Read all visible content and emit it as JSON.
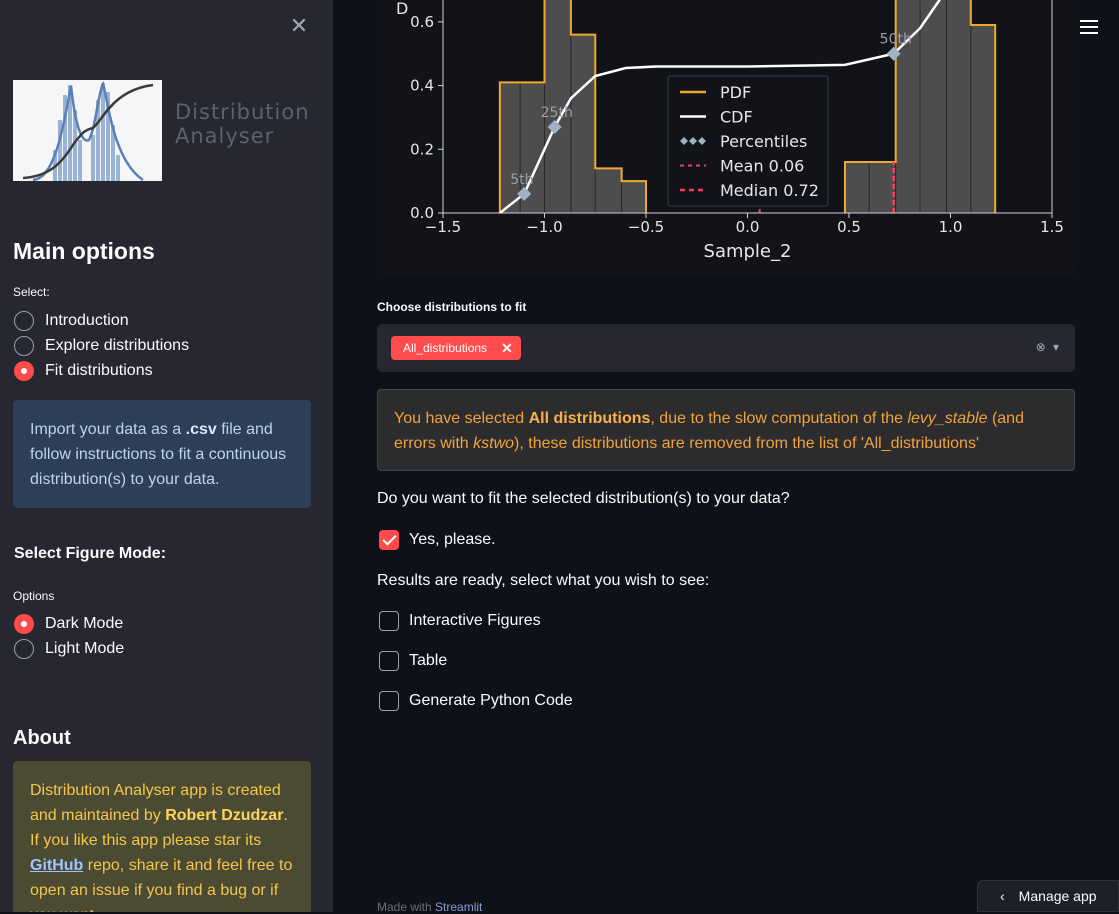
{
  "sidebar": {
    "close_icon": "close-icon",
    "logo_text_line1": "Distribution",
    "logo_text_line2": "Analyser",
    "main_options_heading": "Main options",
    "select_label": "Select:",
    "nav_options": [
      {
        "label": "Introduction",
        "selected": false
      },
      {
        "label": "Explore distributions",
        "selected": false
      },
      {
        "label": "Fit distributions",
        "selected": true
      }
    ],
    "info_text_1": "Import your data as a ",
    "info_text_bold": ".csv",
    "info_text_2": " file and follow instructions to fit a continuous distribution(s) to your data.",
    "figure_mode_heading": "Select Figure Mode:",
    "options_label": "Options",
    "mode_options": [
      {
        "label": "Dark Mode",
        "selected": true
      },
      {
        "label": "Light Mode",
        "selected": false
      }
    ],
    "about_heading": "About",
    "about_text_1": "Distribution Analyser app is created and maintained by ",
    "about_author": "Robert Dzudzar",
    "about_text_2": ". If you like this app please star its ",
    "about_link": "GitHub",
    "about_text_3": " repo, share it and feel free to open an issue if you find a bug or if you want"
  },
  "chart_data": {
    "type": "histogram",
    "xlabel": "Sample_2",
    "ylabel": "D",
    "xlim": [
      -1.5,
      1.5
    ],
    "ylim": [
      0.0,
      0.7
    ],
    "xticks": [
      "−1.5",
      "−1.0",
      "−0.5",
      "0.0",
      "0.5",
      "1.0",
      "1.5"
    ],
    "yticks": [
      "0.0",
      "0.2",
      "0.4",
      "0.6"
    ],
    "bins": [
      {
        "x0": -1.22,
        "x1": -1.12,
        "h": 0.41
      },
      {
        "x0": -1.12,
        "x1": -1.0,
        "h": 0.41
      },
      {
        "x0": -1.0,
        "x1": -0.87,
        "h": 0.72
      },
      {
        "x0": -0.87,
        "x1": -0.75,
        "h": 0.56
      },
      {
        "x0": -0.75,
        "x1": -0.62,
        "h": 0.14
      },
      {
        "x0": -0.62,
        "x1": -0.5,
        "h": 0.1
      },
      {
        "x0": 0.48,
        "x1": 0.6,
        "h": 0.16
      },
      {
        "x0": 0.6,
        "x1": 0.73,
        "h": 0.16
      },
      {
        "x0": 0.73,
        "x1": 0.85,
        "h": 0.72
      },
      {
        "x0": 0.85,
        "x1": 0.98,
        "h": 0.72
      },
      {
        "x0": 0.98,
        "x1": 1.1,
        "h": 0.72
      },
      {
        "x0": 1.1,
        "x1": 1.22,
        "h": 0.59
      }
    ],
    "cdf_points": [
      [
        -1.22,
        0.0
      ],
      [
        -1.1,
        0.06
      ],
      [
        -0.95,
        0.27
      ],
      [
        -0.87,
        0.36
      ],
      [
        -0.75,
        0.43
      ],
      [
        -0.6,
        0.455
      ],
      [
        -0.45,
        0.46
      ],
      [
        0.0,
        0.46
      ],
      [
        0.48,
        0.465
      ],
      [
        0.72,
        0.5
      ],
      [
        0.85,
        0.58
      ],
      [
        0.98,
        0.7
      ]
    ],
    "percentiles": [
      {
        "label": "5th",
        "x": -1.1,
        "y": 0.06
      },
      {
        "label": "25th",
        "x": -0.95,
        "y": 0.27
      },
      {
        "label": "50th",
        "x": 0.72,
        "y": 0.5
      }
    ],
    "mean": 0.06,
    "median": 0.72,
    "legend": [
      "PDF",
      "CDF",
      "Percentiles",
      "Mean 0.06",
      "Median 0.72"
    ],
    "legend_position": "center",
    "colors": {
      "pdf": "#f0a92a",
      "cdf": "#ffffff",
      "percentiles": "#9fb2c6",
      "mean": "#e0455a",
      "median": "#ff3b5c",
      "bars": "#4d4d4d"
    }
  },
  "main": {
    "hamburger_icon": "hamburger-menu-icon",
    "choose_label": "Choose distributions to fit",
    "tag_label": "All_distributions",
    "warning_text_1": "You have selected ",
    "warning_bold": "All distributions",
    "warning_text_2": ", due to the slow computation of the ",
    "warning_italic_1": "levy_stable",
    "warning_text_3": " (and errors with ",
    "warning_italic_2": "kstwo",
    "warning_text_4": "), these distributions are removed from the list of 'All_distributions'",
    "fit_question": "Do you want to fit the selected distribution(s) to your data?",
    "fit_checkbox": {
      "label": "Yes, please.",
      "checked": true
    },
    "results_text": "Results are ready, select what you wish to see:",
    "result_options": [
      {
        "label": "Interactive Figures",
        "checked": false
      },
      {
        "label": "Table",
        "checked": false
      },
      {
        "label": "Generate Python Code",
        "checked": false
      }
    ],
    "footer_made": "Made with ",
    "footer_link": "Streamlit",
    "manage_app": "Manage app"
  },
  "colors": {
    "accent": "#ff4b4b",
    "sidebar_bg": "#262730",
    "main_bg": "#0e1117",
    "warning_text": "#f0a23a"
  }
}
